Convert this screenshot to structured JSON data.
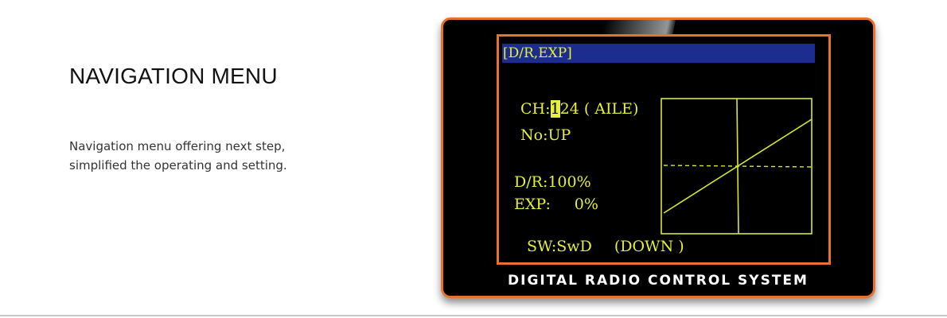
{
  "feature": {
    "title": "NAVIGATION MENU",
    "description_lines": [
      "Navigation menu offering next step,",
      "simplified the operating and setting."
    ]
  },
  "screen": {
    "header": "[D/R,EXP]",
    "channel_label": "CH:",
    "channel_cursor": "1",
    "channel_rest": "24 ( AILE)",
    "no_text": "No:UP",
    "dr_text": "D/R:100%",
    "exp_label": "EXP:",
    "exp_value": "0%",
    "sw_text": "SW:SwD",
    "sw_state": "(DOWN )",
    "colors": {
      "lcd_text": "#e6ef3a",
      "header_bg": "#1d2d8f",
      "frame": "#e8722a"
    }
  },
  "device": {
    "brand_text": "DIGITAL RADIO CONTROL SYSTEM"
  }
}
